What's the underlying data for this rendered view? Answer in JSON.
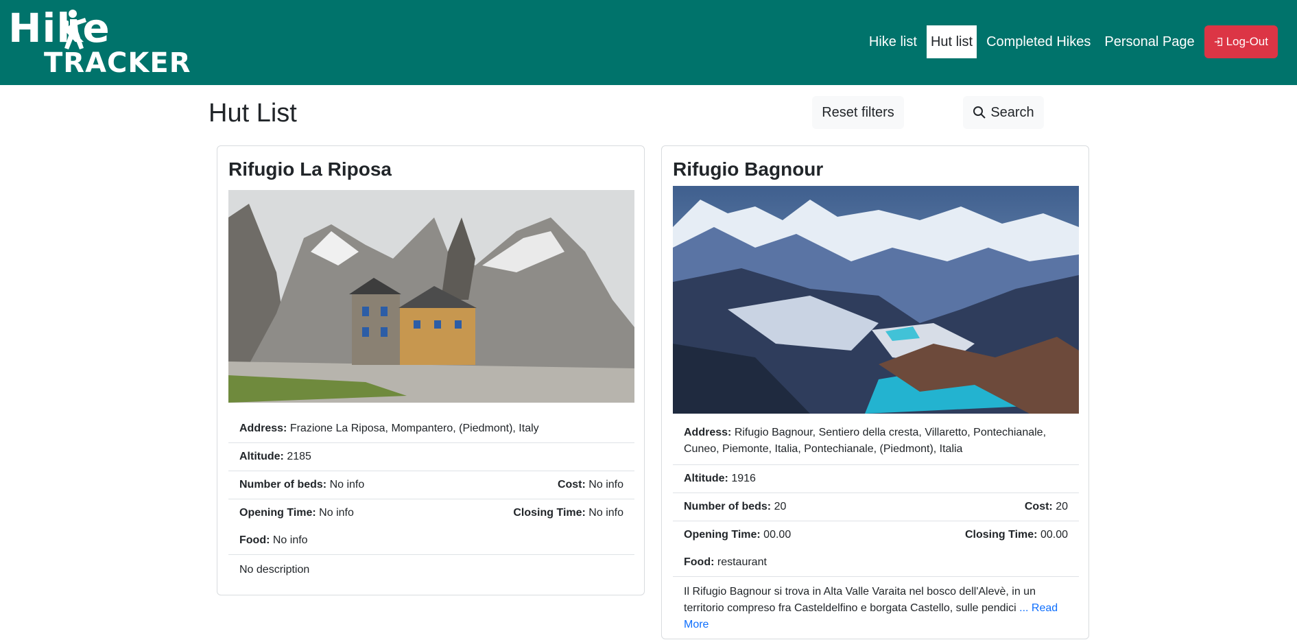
{
  "nav": {
    "logo_top": "Hike",
    "logo_bottom": "TRACKER",
    "links": [
      "Hike list",
      "Hut list",
      "Completed Hikes",
      "Personal Page"
    ],
    "logout": "Log-Out",
    "accent": "#00736b",
    "logout_color": "#dc3545"
  },
  "page": {
    "title": "Hut List",
    "reset_label": "Reset filters",
    "search_label": "Search"
  },
  "huts": [
    {
      "name": "Rifugio La Riposa",
      "address_label": "Address:",
      "address": "Frazione La Riposa, Mompantero, (Piedmont), Italy",
      "altitude_label": "Altitude:",
      "altitude": "2185",
      "beds_label": "Number of beds:",
      "beds": "No info",
      "cost_label": "Cost:",
      "cost": "No info",
      "opening_label": "Opening Time:",
      "opening": "No info",
      "closing_label": "Closing Time:",
      "closing": "No info",
      "food_label": "Food:",
      "food": "No info",
      "description": "No description"
    },
    {
      "name": "Rifugio Bagnour",
      "address_label": "Address:",
      "address": "Rifugio Bagnour, Sentiero della cresta, Villaretto, Pontechianale, Cuneo, Piemonte, Italia, Pontechianale, (Piedmont), Italia",
      "altitude_label": "Altitude:",
      "altitude": "1916",
      "beds_label": "Number of beds:",
      "beds": "20",
      "cost_label": "Cost:",
      "cost": "20",
      "opening_label": "Opening Time:",
      "opening": "00.00",
      "closing_label": "Closing Time:",
      "closing": "00.00",
      "food_label": "Food:",
      "food": "restaurant",
      "description": "Il Rifugio Bagnour si trova in Alta Valle Varaita nel bosco dell'Alevè, in un territorio compreso fra Casteldelfino e borgata Castello, sulle pendici",
      "read_more": "... Read More"
    }
  ]
}
